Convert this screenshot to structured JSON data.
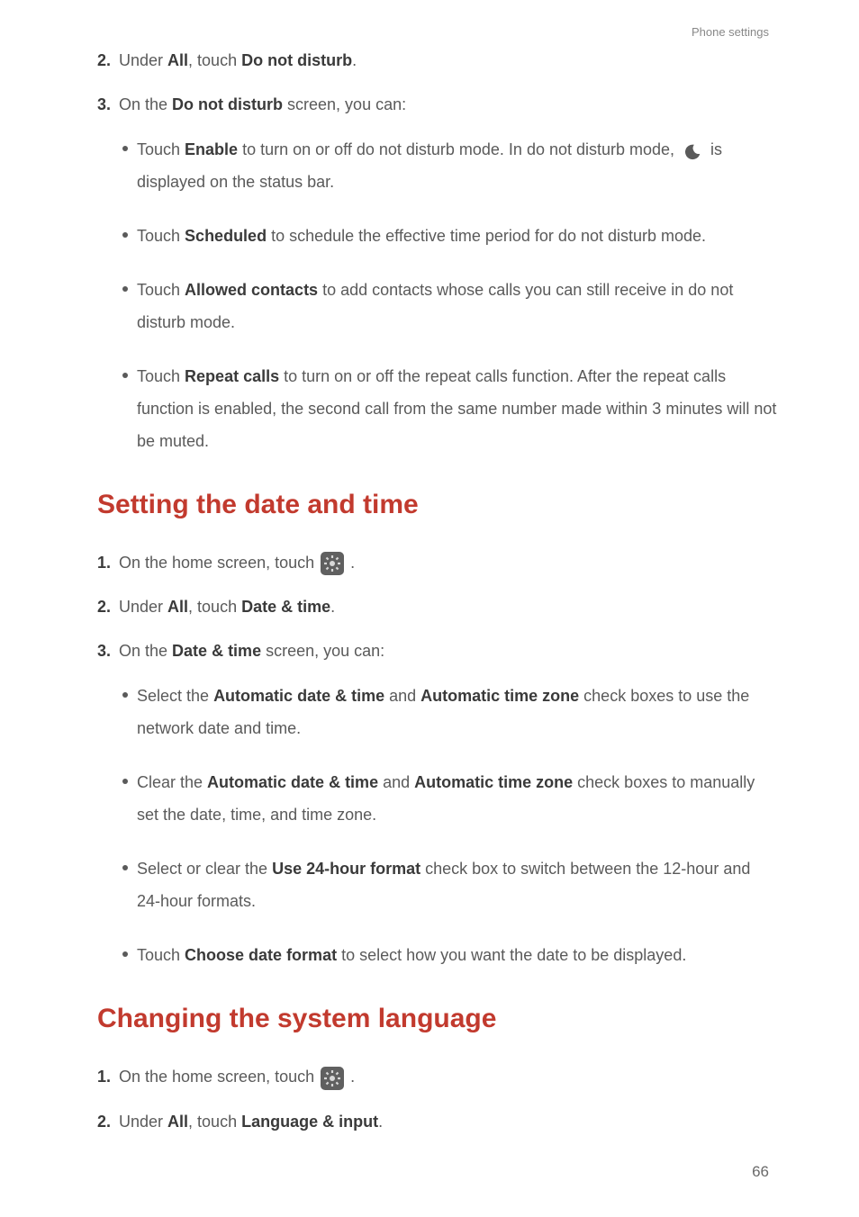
{
  "header": {
    "breadcrumb": "Phone settings"
  },
  "sectionA": {
    "step2": {
      "num": "2.",
      "t1": "Under ",
      "b1": "All",
      "t2": ", touch ",
      "b2": "Do not disturb",
      "t3": "."
    },
    "step3": {
      "num": "3.",
      "t1": "On the ",
      "b1": "Do not disturb",
      "t2": " screen, you can:"
    },
    "bullets": {
      "b1": {
        "t1": "Touch ",
        "bold1": "Enable",
        "t2": " to turn on or off do not disturb mode. In do not disturb mode, ",
        "t3": " is displayed on the status bar."
      },
      "b2": {
        "t1": "Touch ",
        "bold1": "Scheduled",
        "t2": " to schedule the effective time period for do not disturb mode."
      },
      "b3": {
        "t1": "Touch ",
        "bold1": "Allowed contacts",
        "t2": " to add contacts whose calls you can still receive in do not disturb mode."
      },
      "b4": {
        "t1": "Touch ",
        "bold1": "Repeat calls",
        "t2": " to turn on or off the repeat calls function. After the repeat calls function is enabled, the second call from the same number made within 3 minutes will not be muted."
      }
    }
  },
  "sectionB": {
    "title": "Setting the date and time",
    "step1": {
      "num": "1.",
      "t1": "On the home screen, touch ",
      "t2": " ."
    },
    "step2": {
      "num": "2.",
      "t1": "Under ",
      "b1": "All",
      "t2": ", touch ",
      "b2": "Date & time",
      "t3": "."
    },
    "step3": {
      "num": "3.",
      "t1": "On the ",
      "b1": "Date & time",
      "t2": " screen, you can:"
    },
    "bullets": {
      "b1": {
        "t1": "Select the ",
        "bold1": "Automatic date & time",
        "t2": " and ",
        "bold2": "Automatic time zone",
        "t3": " check boxes to use the network date and time."
      },
      "b2": {
        "t1": "Clear the ",
        "bold1": "Automatic date & time",
        "t2": " and ",
        "bold2": "Automatic time zone",
        "t3": " check boxes to manually set the date, time, and time zone."
      },
      "b3": {
        "t1": "Select or clear the ",
        "bold1": "Use 24-hour format",
        "t2": " check box to switch between the 12-hour and 24-hour formats."
      },
      "b4": {
        "t1": "Touch ",
        "bold1": "Choose date format",
        "t2": " to select how you want the date to be displayed."
      }
    }
  },
  "sectionC": {
    "title": "Changing the system language",
    "step1": {
      "num": "1.",
      "t1": "On the home screen, touch ",
      "t2": " ."
    },
    "step2": {
      "num": "2.",
      "t1": "Under ",
      "b1": "All",
      "t2": ", touch ",
      "b2": "Language & input",
      "t3": "."
    }
  },
  "page": "66"
}
